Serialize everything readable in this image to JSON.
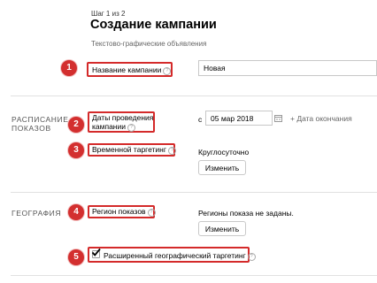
{
  "header": {
    "step": "Шаг 1 из 2",
    "title": "Создание кампании",
    "subtitle": "Текстово-графические объявления"
  },
  "sections": {
    "schedule": "РАСПИСАНИЕ ПОКАЗОВ",
    "geography": "ГЕОГРАФИЯ"
  },
  "badges": [
    "1",
    "2",
    "3",
    "4",
    "5"
  ],
  "fields": {
    "campaign_name": {
      "label": "Название кампании",
      "value": "Новая"
    },
    "dates": {
      "label": "Даты проведения кампании",
      "from_prefix": "с",
      "start_date": "05 мар 2018",
      "end_link": "+ Дата окончания"
    },
    "targeting": {
      "label": "Временной таргетинг",
      "value": "Круглосуточно",
      "button": "Изменить"
    },
    "regions": {
      "label": "Регион показов",
      "value": "Регионы показа не заданы.",
      "button": "Изменить"
    },
    "extended_geo": {
      "label": "Расширенный географический таргетинг",
      "checked": true
    }
  },
  "icons": {
    "help": "question-circle-icon",
    "calendar": "calendar-icon",
    "check": "checkmark-icon"
  },
  "colors": {
    "highlight": "#d42a2a",
    "badge": "#d32f2f"
  }
}
